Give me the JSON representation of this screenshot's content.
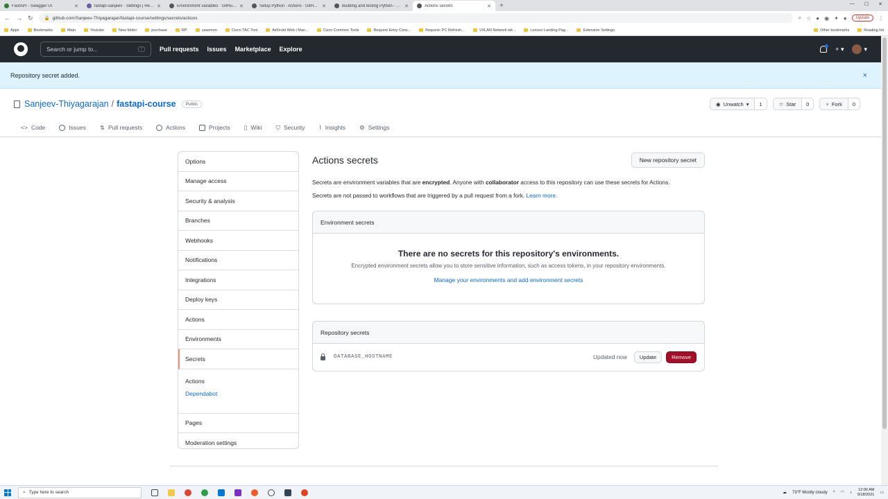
{
  "browser": {
    "tabs": [
      {
        "label": "FastAPI - Swagger UI",
        "color": "#2e7d32"
      },
      {
        "label": "fastapi-sanjeev · Settings | Heroku",
        "color": "#6762a6"
      },
      {
        "label": "Environment variables · GitHub Docs",
        "color": "#24292f"
      },
      {
        "label": "Setup Python · Actions · GitHub Marketplace",
        "color": "#24292f"
      },
      {
        "label": "Building and testing Python - GitHub Docs",
        "color": "#24292f"
      },
      {
        "label": "Actions secrets",
        "color": "#24292f"
      }
    ],
    "url": "github.com/Sanjeev-Thiyagarajan/fastapi-course/settings/secrets/actions",
    "update_label": "Update",
    "bookmarks": [
      "Apps",
      "Bookmarks",
      "Main",
      "Youtube",
      "New folder",
      "purchase",
      "RP",
      "casemon",
      "Cisco TAC Tool",
      "AirDroid Web | Man...",
      "Cisco Common Tools",
      "Request Entry Cons...",
      "Request: PC Refresh...",
      "VXLAN Network wit...",
      "Lenovo Landing Pag...",
      "Extension Settings"
    ],
    "bookmarks_right": [
      "Other bookmarks",
      "Reading list"
    ]
  },
  "github": {
    "search_placeholder": "Search or jump to...",
    "search_key": "/",
    "nav": [
      "Pull requests",
      "Issues",
      "Marketplace",
      "Explore"
    ],
    "plus": "+",
    "caret": "▾"
  },
  "flash": {
    "message": "Repository secret added.",
    "close": "×"
  },
  "repo": {
    "owner": "Sanjeev-Thiyagarajan",
    "separator": "/",
    "name": "fastapi-course",
    "visibility": "Public",
    "unwatch_label": "Unwatch",
    "unwatch_count": "1",
    "star_label": "Star",
    "star_count": "0",
    "fork_label": "Fork",
    "fork_count": "0",
    "tabs": [
      "Code",
      "Issues",
      "Pull requests",
      "Actions",
      "Projects",
      "Wiki",
      "Security",
      "Insights",
      "Settings"
    ]
  },
  "sidebar": {
    "items": [
      "Options",
      "Manage access",
      "Security & analysis",
      "Branches",
      "Webhooks",
      "Notifications",
      "Integrations",
      "Deploy keys",
      "Actions",
      "Environments",
      "Secrets"
    ],
    "sub_heading": "Actions",
    "sub_link": "Dependabot",
    "tail_items": [
      "Pages",
      "Moderation settings"
    ]
  },
  "main": {
    "title": "Actions secrets",
    "new_secret_label": "New repository secret",
    "desc1_a": "Secrets are environment variables that are ",
    "desc1_b": "encrypted",
    "desc1_c": ". Anyone with ",
    "desc1_d": "collaborator",
    "desc1_e": " access to this repository can use these secrets for Actions.",
    "desc2_a": "Secrets are not passed to workflows that are triggered by a pull request from a fork. ",
    "desc2_link": "Learn more.",
    "env_heading": "Environment secrets",
    "env_empty_title": "There are no secrets for this repository's environments.",
    "env_empty_desc": "Encrypted environment secrets allow you to store sensitive information, such as access tokens, in your repository environments.",
    "env_manage_link": "Manage your environments and add environment secrets",
    "repo_heading": "Repository secrets",
    "secret_name": "DATABASE_HOSTNAME",
    "secret_updated": "Updated now",
    "update_label": "Update",
    "remove_label": "Remove"
  },
  "taskbar": {
    "search_placeholder": "Type here to search",
    "weather": "73°F  Mostly cloudy",
    "time": "12:00 AM",
    "date": "9/18/2021"
  }
}
